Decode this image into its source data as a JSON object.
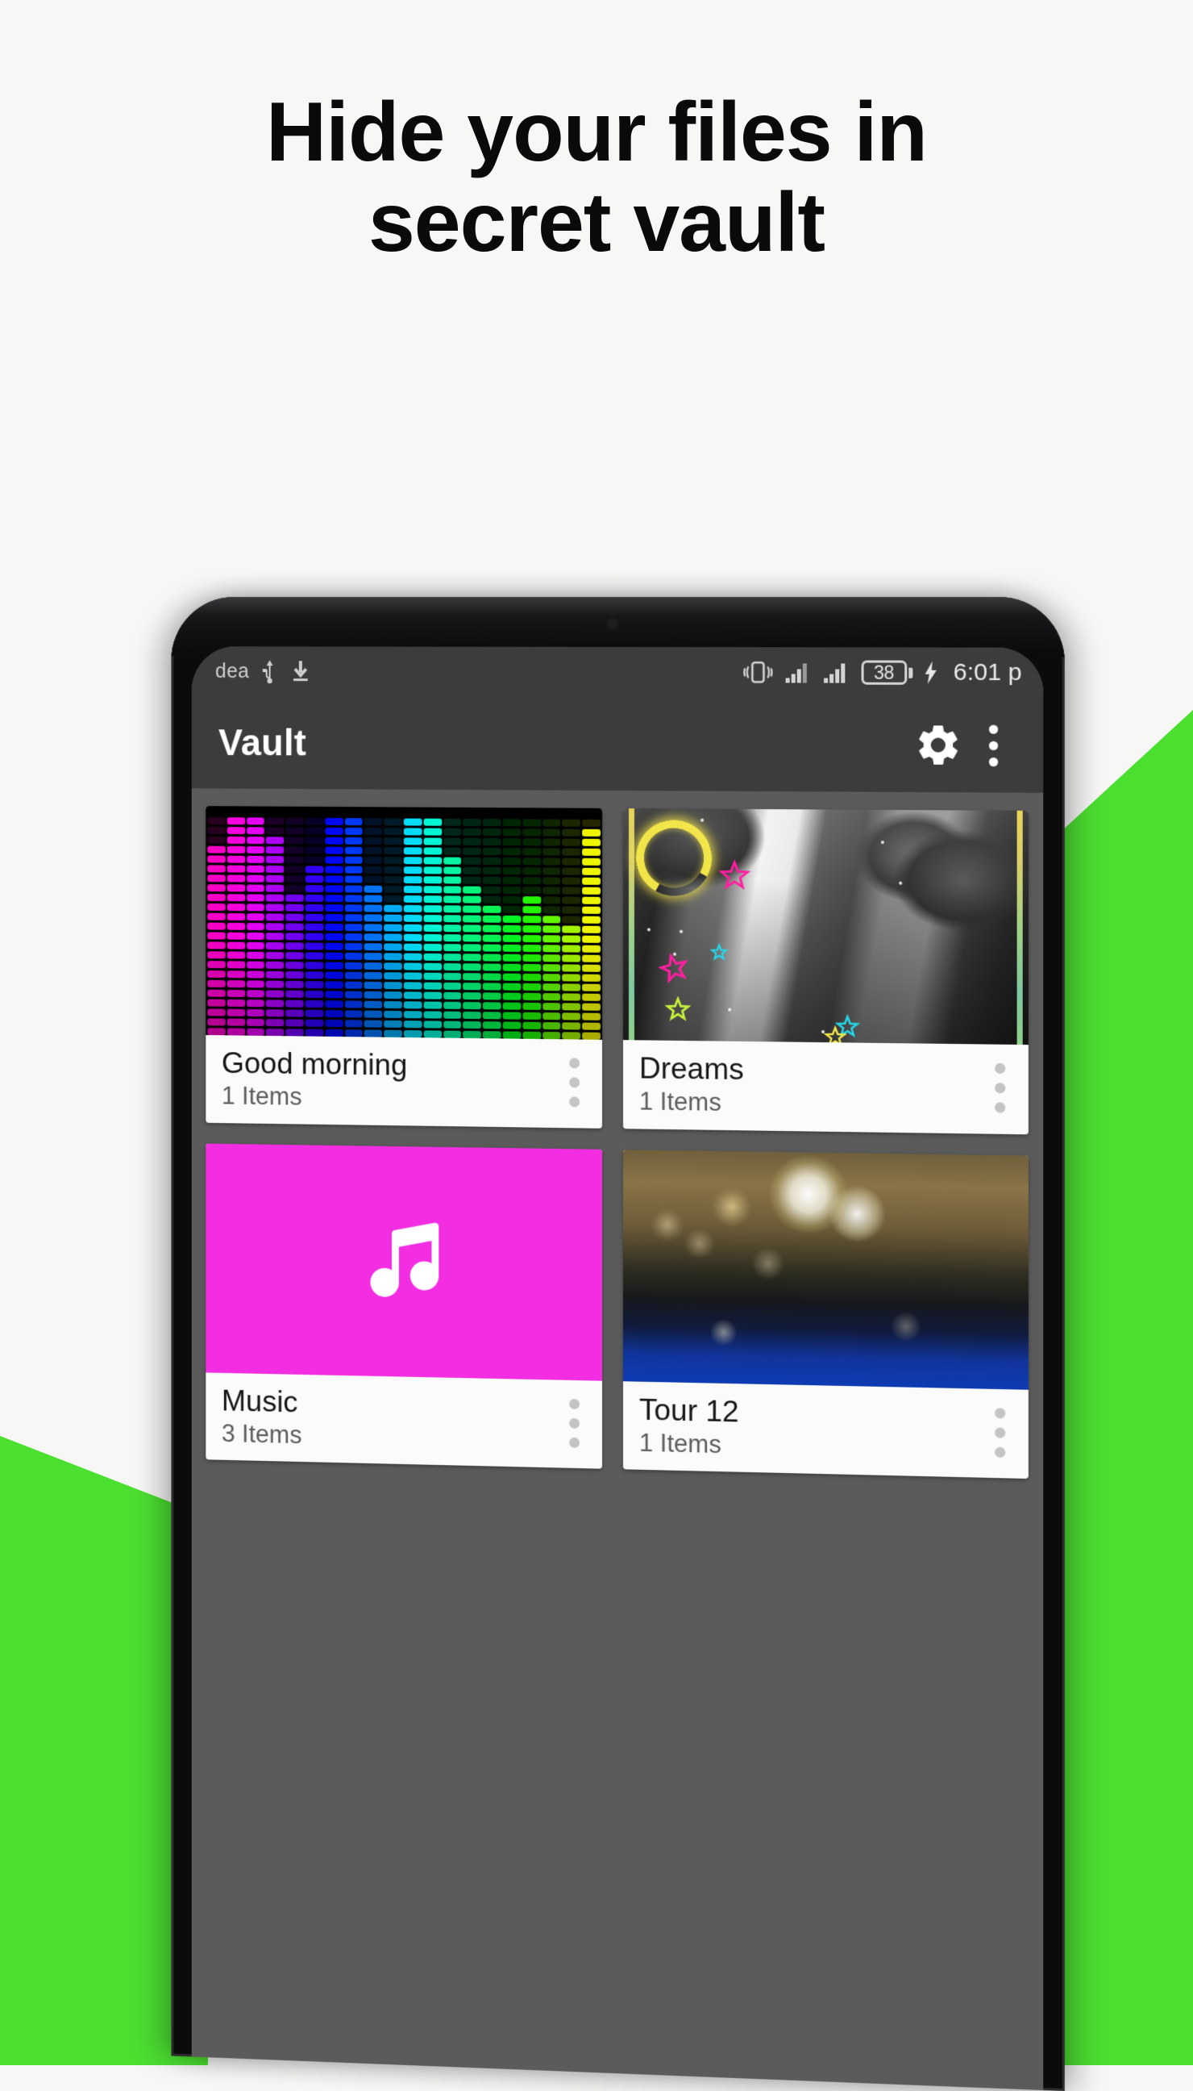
{
  "headline": {
    "line1": "Hide your files in",
    "line2": "secret vault"
  },
  "theme": {
    "page_background": "#F7F7F6",
    "accent_green": "#4BDF30",
    "app_bar_background": "#3C3C3C",
    "screen_background": "#5B5B5B",
    "card_background": "#FBFBFB",
    "music_tile_color": "#F22DE2",
    "title_color": "#0A0A0A"
  },
  "status_bar": {
    "carrier": "dea",
    "icons_left": [
      "usb-icon",
      "download-icon"
    ],
    "icons_right": [
      "vibrate-icon",
      "signal-icon",
      "signal-icon",
      "battery-icon",
      "charging-bolt-icon"
    ],
    "battery_level": "38",
    "time": "6:01 p"
  },
  "app_bar": {
    "title": "Vault",
    "settings_label": "Settings",
    "overflow_label": "More options"
  },
  "folders": [
    {
      "title": "Good morning",
      "count": "1 Items",
      "thumb_type": "equalizer",
      "menu_label": "Folder options"
    },
    {
      "title": "Dreams",
      "count": "1 Items",
      "thumb_type": "photo-stars",
      "menu_label": "Folder options"
    },
    {
      "title": "Music",
      "count": "3 Items",
      "thumb_type": "music-note",
      "menu_label": "Folder options"
    },
    {
      "title": "Tour 12",
      "count": "1 Items",
      "thumb_type": "photo-bokeh",
      "menu_label": "Folder options"
    }
  ]
}
